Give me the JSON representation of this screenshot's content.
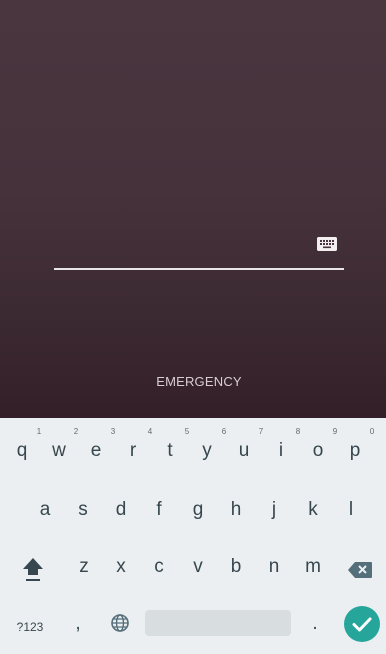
{
  "lock_screen": {
    "emergency_label": "EMERGENCY"
  },
  "keyboard": {
    "row1": [
      {
        "label": "q",
        "hint": "1"
      },
      {
        "label": "w",
        "hint": "2"
      },
      {
        "label": "e",
        "hint": "3"
      },
      {
        "label": "r",
        "hint": "4"
      },
      {
        "label": "t",
        "hint": "5"
      },
      {
        "label": "y",
        "hint": "6"
      },
      {
        "label": "u",
        "hint": "7"
      },
      {
        "label": "i",
        "hint": "8"
      },
      {
        "label": "o",
        "hint": "9"
      },
      {
        "label": "p",
        "hint": "0"
      }
    ],
    "row2": [
      "a",
      "s",
      "d",
      "f",
      "g",
      "h",
      "j",
      "k",
      "l"
    ],
    "row3": [
      "z",
      "x",
      "c",
      "v",
      "b",
      "n",
      "m"
    ],
    "symbols_label": "?123",
    "comma_label": ",",
    "period_label": ".",
    "icons": {
      "shift": "shift-icon",
      "delete": "backspace-icon",
      "language": "globe-icon",
      "enter": "checkmark-icon",
      "password_keyboard": "keyboard-icon"
    },
    "colors": {
      "background": "#eceff1",
      "key_text": "#37474f",
      "enter": "#26a69a"
    }
  }
}
